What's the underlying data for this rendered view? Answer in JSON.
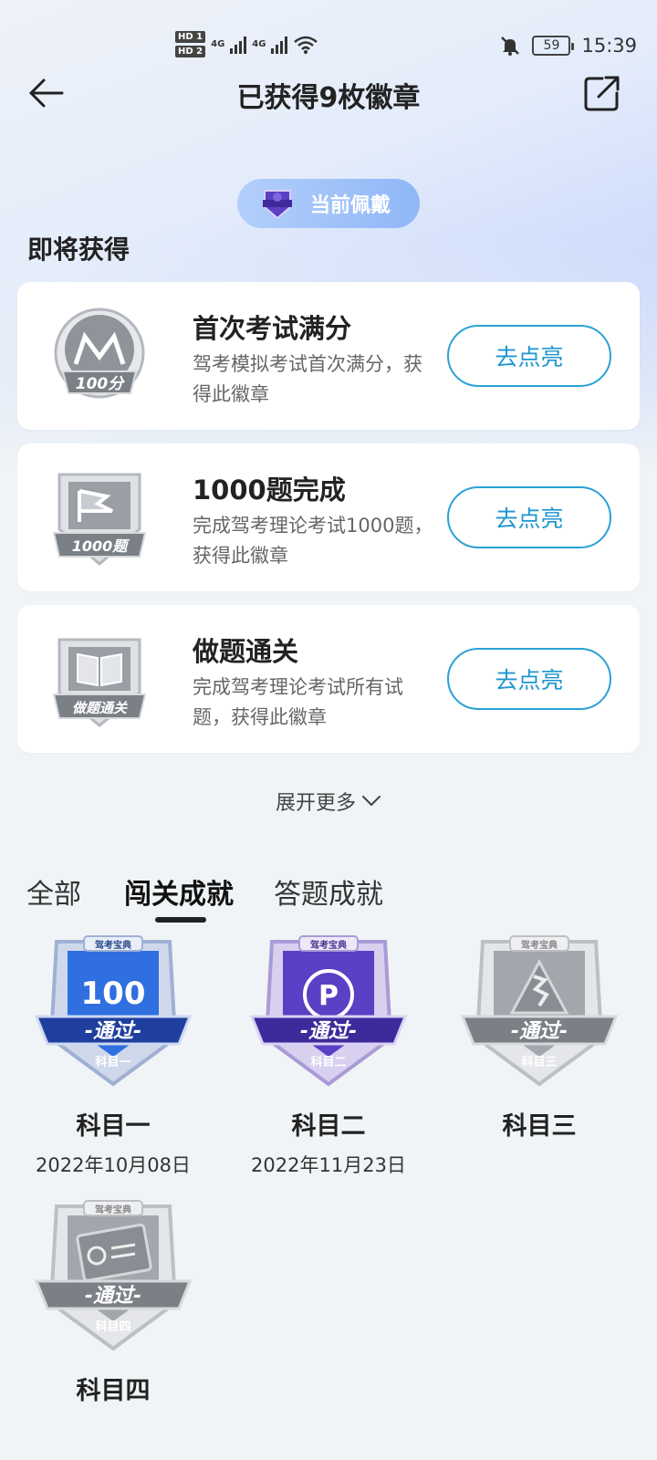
{
  "status_bar": {
    "hd1": "HD 1",
    "hd2": "HD 2",
    "net1": "4G",
    "net2": "4G",
    "battery": "59",
    "time": "15:39"
  },
  "header": {
    "title": "已获得9枚徽章"
  },
  "wearing": {
    "label": "当前佩戴"
  },
  "upcoming": {
    "title": "即将获得",
    "cards": [
      {
        "badge_text": "100分",
        "title": "首次考试满分",
        "desc": "驾考模拟考试首次满分，获得此徽章",
        "button": "去点亮"
      },
      {
        "badge_text": "1000题",
        "title": "1000题完成",
        "desc": "完成驾考理论考试1000题，获得此徽章",
        "button": "去点亮"
      },
      {
        "badge_text": "做题通关",
        "title": "做题通关",
        "desc": "完成驾考理论考试所有试题，获得此徽章",
        "button": "去点亮"
      }
    ],
    "expand_label": "展开更多"
  },
  "tabs": [
    {
      "label": "全部"
    },
    {
      "label": "闯关成就"
    },
    {
      "label": "答题成就"
    }
  ],
  "badges": [
    {
      "name": "科目一",
      "date": "2022年10月08日",
      "ribbon": "-通过-",
      "sub": "科目一",
      "top": "100",
      "brand": "驾考宝典",
      "color": "blue"
    },
    {
      "name": "科目二",
      "date": "2022年11月23日",
      "ribbon": "-通过-",
      "sub": "科目二",
      "top": "P",
      "brand": "驾考宝典",
      "color": "purple"
    },
    {
      "name": "科目三",
      "date": "",
      "ribbon": "-通过-",
      "sub": "科目三",
      "top": "",
      "brand": "驾考宝典",
      "color": "gray"
    },
    {
      "name": "科目四",
      "date": "",
      "ribbon": "-通过-",
      "sub": "科目四",
      "top": "",
      "brand": "驾考宝典",
      "color": "gray"
    }
  ],
  "colors": {
    "accent": "#1e95cf",
    "badge_blue": "#2f6fe0",
    "badge_purple": "#5b3fc4",
    "badge_gray": "#9a9ea4"
  }
}
